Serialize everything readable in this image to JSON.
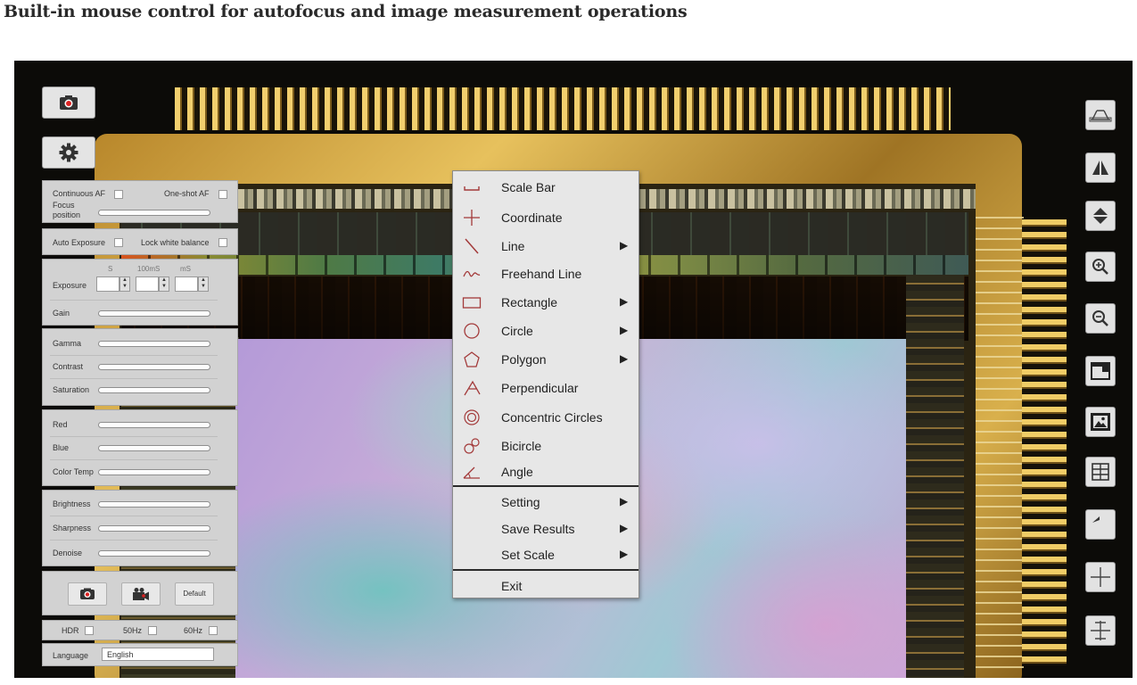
{
  "headline": "Built-in mouse control for autofocus and image measurement operations",
  "controls": {
    "continuous_af": "Continuous AF",
    "one_shot_af": "One-shot AF",
    "focus_position_1": "Focus",
    "focus_position_2": "position",
    "auto_exposure": "Auto Exposure",
    "lock_white_balance": "Lock white balance",
    "exposure": "Exposure",
    "exposure_units": {
      "s": "S",
      "ms100": "100mS",
      "ms": "mS"
    },
    "gain": "Gain",
    "gamma": "Gamma",
    "contrast": "Contrast",
    "saturation": "Saturation",
    "red": "Red",
    "blue": "Blue",
    "color_temp": "Color Temp",
    "brightness": "Brightness",
    "sharpness": "Sharpness",
    "denoise": "Denoise",
    "default_button": "Default",
    "hdr": "HDR",
    "hz50": "50Hz",
    "hz60": "60Hz",
    "language": "Language",
    "language_value": "English"
  },
  "menu": {
    "items": [
      {
        "label": "Scale Bar",
        "icon": "scale-bar-icon",
        "submenu": false
      },
      {
        "label": "Coordinate",
        "icon": "coordinate-icon",
        "submenu": false
      },
      {
        "label": "Line",
        "icon": "line-icon",
        "submenu": true
      },
      {
        "label": "Freehand Line",
        "icon": "freehand-line-icon",
        "submenu": false
      },
      {
        "label": "Rectangle",
        "icon": "rectangle-icon",
        "submenu": true
      },
      {
        "label": "Circle",
        "icon": "circle-icon",
        "submenu": true
      },
      {
        "label": "Polygon",
        "icon": "polygon-icon",
        "submenu": true
      },
      {
        "label": "Perpendicular",
        "icon": "perpendicular-icon",
        "submenu": false
      },
      {
        "label": "Concentric Circles",
        "icon": "concentric-circles-icon",
        "submenu": false
      },
      {
        "label": "Bicircle",
        "icon": "bicircle-icon",
        "submenu": false
      },
      {
        "label": "Angle",
        "icon": "angle-icon",
        "submenu": false
      }
    ],
    "settings": [
      {
        "label": "Setting",
        "submenu": true
      },
      {
        "label": "Save Results",
        "submenu": true
      },
      {
        "label": "Set Scale",
        "submenu": true
      }
    ],
    "exit": "Exit",
    "arrow": "▶"
  },
  "toolbar_icons": [
    "measure-icon",
    "flip-horizontal-icon",
    "flip-vertical-icon",
    "zoom-in-icon",
    "zoom-out-icon",
    "window-icon",
    "image-icon",
    "grid-icon",
    "undo-icon",
    "crosshair-icon",
    "crosshair-center-icon"
  ],
  "colors": {
    "menu_icon": "#a33a3a",
    "panel": "#d2d2d2",
    "menu_bg": "#e7e7e7"
  }
}
